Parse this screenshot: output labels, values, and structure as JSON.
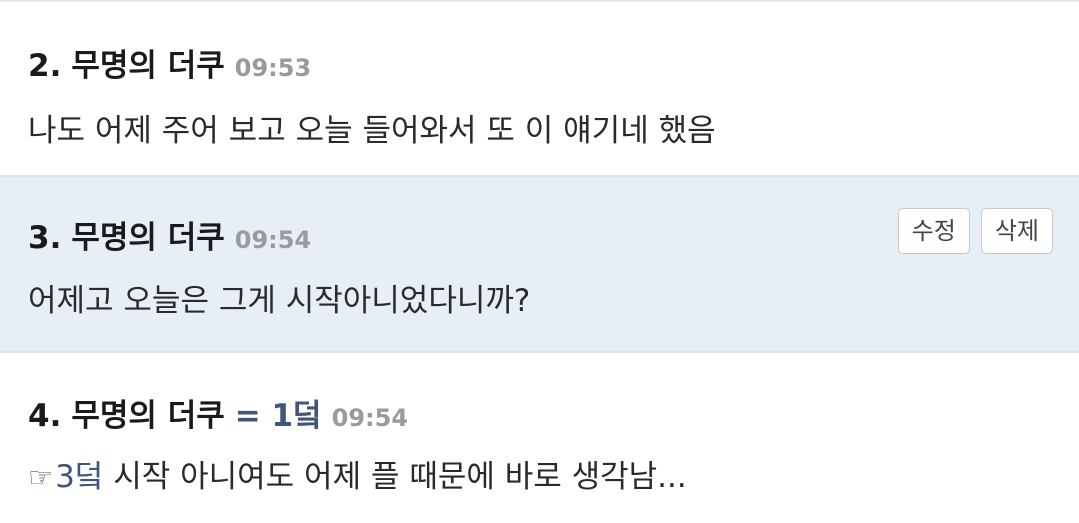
{
  "comments": [
    {
      "number": "2.",
      "author": "무명의 더쿠",
      "time": "09:53",
      "text": "나도 어제 주어 보고 오늘 들어와서 또 이 얘기네 했음"
    },
    {
      "number": "3.",
      "author": "무명의 더쿠",
      "time": "09:54",
      "text": "어제고 오늘은 그게 시작아니었다니까?",
      "actions": {
        "edit_label": "수정",
        "delete_label": "삭제"
      }
    },
    {
      "number": "4.",
      "author": "무명의 더쿠",
      "badge": "= 1덬",
      "time": "09:54",
      "reply_icon": "pointing-hand-icon",
      "reply_glyph": "☞",
      "reply_to": "3덬",
      "text": " 시작 아니여도 어제 플 때문에 바로 생각남..."
    }
  ],
  "colors": {
    "highlight_bg": "#e8eef5",
    "link": "#40567a",
    "time": "#9a9a9a"
  }
}
